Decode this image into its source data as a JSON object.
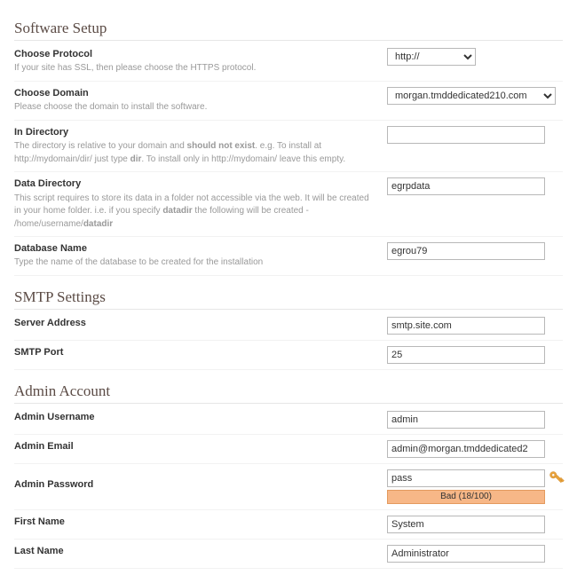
{
  "sections": {
    "software_setup": {
      "title": "Software Setup",
      "protocol": {
        "label": "Choose Protocol",
        "help": "If your site has SSL, then please choose the HTTPS protocol.",
        "value": "http://"
      },
      "domain": {
        "label": "Choose Domain",
        "help": "Please choose the domain to install the software.",
        "value": "morgan.tmddedicated210.com"
      },
      "directory": {
        "label": "In Directory",
        "help_pre": "The directory is relative to your domain and ",
        "help_bold1": "should not exist",
        "help_mid": ". e.g. To install at http://mydomain/dir/ just type ",
        "help_bold2": "dir",
        "help_post": ". To install only in http://mydomain/ leave this empty.",
        "value": ""
      },
      "datadir": {
        "label": "Data Directory",
        "help_pre": "This script requires to store its data in a folder not accessible via the web. It will be created in your home folder. i.e. if you specify ",
        "help_bold1": "datadir",
        "help_mid": " the following will be created - /home/username/",
        "help_bold2": "datadir",
        "value": "egrpdata"
      },
      "dbname": {
        "label": "Database Name",
        "help": "Type the name of the database to be created for the installation",
        "value": "egrou79"
      }
    },
    "smtp": {
      "title": "SMTP Settings",
      "server": {
        "label": "Server Address",
        "value": "smtp.site.com"
      },
      "port": {
        "label": "SMTP Port",
        "value": "25"
      }
    },
    "admin": {
      "title": "Admin Account",
      "username": {
        "label": "Admin Username",
        "value": "admin"
      },
      "email": {
        "label": "Admin Email",
        "value": "admin@morgan.tmddedicated2"
      },
      "password": {
        "label": "Admin Password",
        "value": "pass",
        "strength": "Bad (18/100)"
      },
      "first": {
        "label": "First Name",
        "value": "System"
      },
      "last": {
        "label": "Last Name",
        "value": "Administrator"
      }
    }
  }
}
